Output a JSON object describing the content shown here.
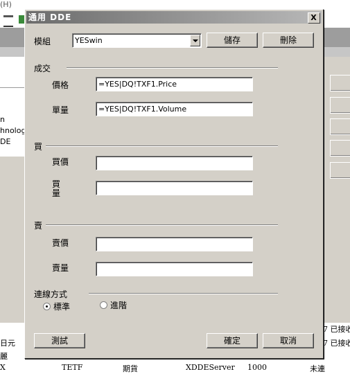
{
  "background": {
    "menu_hint": "(H)",
    "left_list": [
      "n",
      "hnologie",
      "DE"
    ],
    "bottom_row": [
      "日元",
      "TETF",
      "期貨",
      "XDDEServer",
      "1000",
      "未連"
    ],
    "bottom_left_row2": "麗",
    "bottom_left_row3": "X",
    "right_col": [
      "7 已接收",
      "7 已接收"
    ]
  },
  "dialog": {
    "title": "通用 DDE",
    "close_label": "X",
    "module_label": "模組",
    "module_value": "YESwin",
    "save_label": "儲存",
    "delete_label": "刪除",
    "trade_group": "成交",
    "price_label": "價格",
    "price_value": "=YES|DQ!TXF1.Price",
    "volume_label": "單量",
    "volume_value": "=YES|DQ!TXF1.Volume",
    "buy_group": "買",
    "bid_price_label": "買價",
    "bid_volume_label": "買\n量",
    "bid_price_value": "",
    "bid_volume_value": "",
    "sell_group": "賣",
    "ask_price_label": "賣價",
    "ask_volume_label": "賣量",
    "ask_price_value": "",
    "ask_volume_value": "",
    "connection_group": "連線方式",
    "radio_standard": "標準",
    "radio_advanced": "進階",
    "selected_connection": "標準",
    "test_label": "測試",
    "ok_label": "確定",
    "cancel_label": "取消"
  }
}
